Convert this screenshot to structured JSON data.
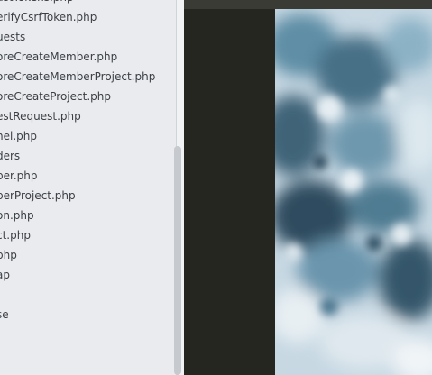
{
  "sidebar": {
    "items": [
      "ustTokens.php",
      "erifyCsrfToken.php",
      "uests",
      "oreCreateMember.php",
      "oreCreateMemberProject.php",
      "oreCreateProject.php",
      "estRequest.php",
      "nel.php",
      "ders",
      "ber.php",
      "berProject.php",
      "on.php",
      "ct.php",
      "php",
      "ap",
      "",
      "se"
    ]
  },
  "preview": {
    "icon": "image-preview"
  }
}
